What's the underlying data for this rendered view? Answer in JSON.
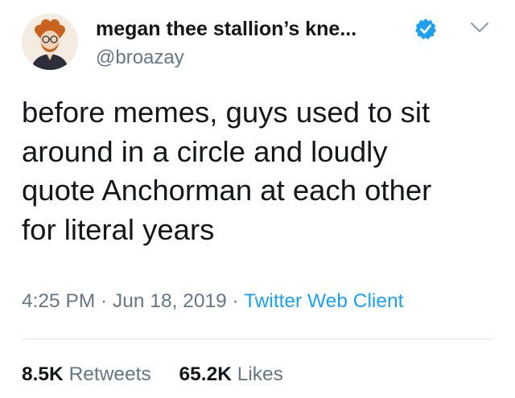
{
  "user": {
    "display_name": "megan thee stallion’s kne...",
    "handle": "@broazay",
    "verified": true
  },
  "icons": {
    "avatar": "cartoon-avatar",
    "verified": "verified-badge-icon",
    "menu": "chevron-down-icon"
  },
  "tweet": {
    "lines": [
      "before memes, guys used to sit",
      "around in a circle and loudly",
      "quote Anchorman at each other",
      "for literal years"
    ]
  },
  "meta": {
    "time": "4:25 PM",
    "sep1": " · ",
    "date": "Jun 18, 2019",
    "sep2": " · ",
    "client": "Twitter Web Client"
  },
  "stats": {
    "retweets_count": "8.5K",
    "retweets_label": "Retweets",
    "likes_count": "65.2K",
    "likes_label": "Likes"
  },
  "colors": {
    "text": "#14171a",
    "secondary": "#657786",
    "link": "#1da1f2",
    "divider": "#e1e8ed"
  }
}
